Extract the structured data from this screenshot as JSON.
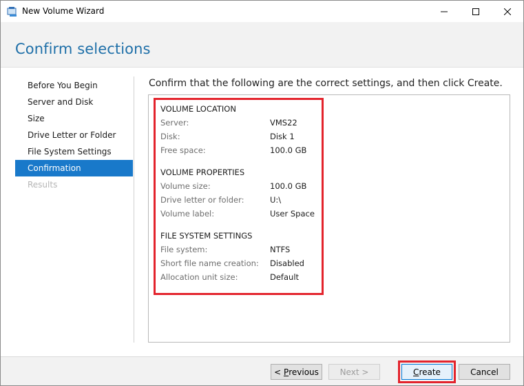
{
  "window": {
    "title": "New Volume Wizard"
  },
  "header": {
    "title": "Confirm selections"
  },
  "nav": {
    "items": [
      {
        "label": "Before You Begin",
        "state": "normal"
      },
      {
        "label": "Server and Disk",
        "state": "normal"
      },
      {
        "label": "Size",
        "state": "normal"
      },
      {
        "label": "Drive Letter or Folder",
        "state": "normal"
      },
      {
        "label": "File System Settings",
        "state": "normal"
      },
      {
        "label": "Confirmation",
        "state": "active"
      },
      {
        "label": "Results",
        "state": "disabled"
      }
    ]
  },
  "main": {
    "instruction": "Confirm that the following are the correct settings, and then click Create.",
    "sections": [
      {
        "heading": "VOLUME LOCATION",
        "rows": [
          {
            "label": "Server:",
            "value": "VMS22"
          },
          {
            "label": "Disk:",
            "value": "Disk 1"
          },
          {
            "label": "Free space:",
            "value": "100.0 GB"
          }
        ]
      },
      {
        "heading": "VOLUME PROPERTIES",
        "rows": [
          {
            "label": "Volume size:",
            "value": "100.0 GB"
          },
          {
            "label": "Drive letter or folder:",
            "value": "U:\\"
          },
          {
            "label": "Volume label:",
            "value": "User Space"
          }
        ]
      },
      {
        "heading": "FILE SYSTEM SETTINGS",
        "rows": [
          {
            "label": "File system:",
            "value": "NTFS"
          },
          {
            "label": "Short file name creation:",
            "value": "Disabled"
          },
          {
            "label": "Allocation unit size:",
            "value": "Default"
          }
        ]
      }
    ]
  },
  "footer": {
    "previous_prefix": "< ",
    "previous_mnemonic": "P",
    "previous_rest": "revious",
    "next_label": "Next >",
    "create_mnemonic": "C",
    "create_rest": "reate",
    "cancel_label": "Cancel"
  },
  "colors": {
    "accent": "#1979ca",
    "title": "#1e6fa8",
    "highlight": "#e3232c"
  }
}
